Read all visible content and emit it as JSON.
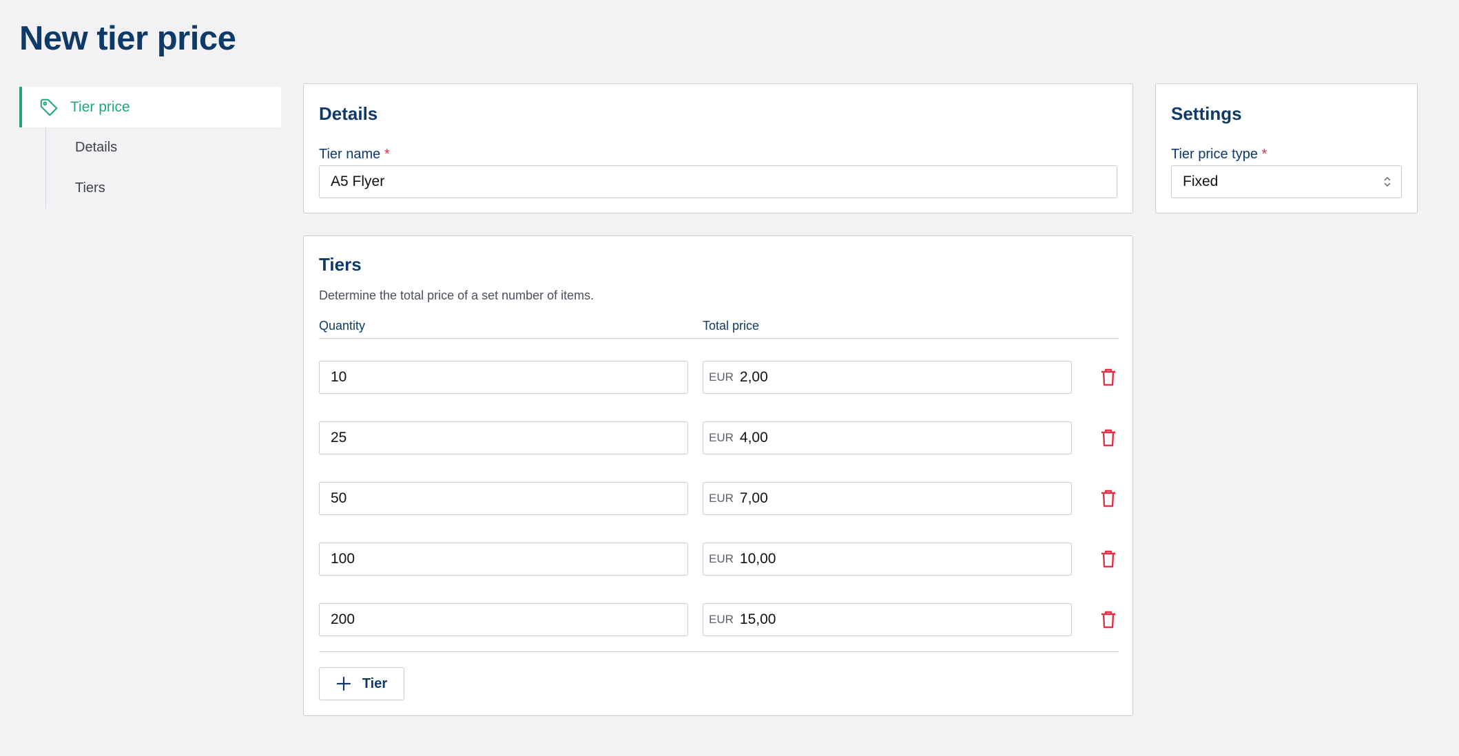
{
  "page": {
    "title": "New tier price"
  },
  "sidebar": {
    "active": {
      "label": "Tier price",
      "icon": "tag-icon"
    },
    "items": [
      {
        "label": "Details"
      },
      {
        "label": "Tiers"
      }
    ]
  },
  "details": {
    "title": "Details",
    "tier_name_label": "Tier name",
    "required_mark": "*",
    "tier_name_value": "A5 Flyer"
  },
  "settings": {
    "title": "Settings",
    "type_label": "Tier price type",
    "required_mark": "*",
    "type_value": "Fixed"
  },
  "tiers": {
    "title": "Tiers",
    "description": "Determine the total price of a set number of items.",
    "quantity_header": "Quantity",
    "price_header": "Total price",
    "currency": "EUR",
    "rows": [
      {
        "quantity": "10",
        "price": "2,00"
      },
      {
        "quantity": "25",
        "price": "4,00"
      },
      {
        "quantity": "50",
        "price": "7,00"
      },
      {
        "quantity": "100",
        "price": "10,00"
      },
      {
        "quantity": "200",
        "price": "15,00"
      }
    ],
    "add_label": "Tier"
  },
  "colors": {
    "accent": "#1fa67a",
    "heading": "#0d3a68",
    "danger": "#e0314b",
    "background": "#f2f2f4"
  }
}
